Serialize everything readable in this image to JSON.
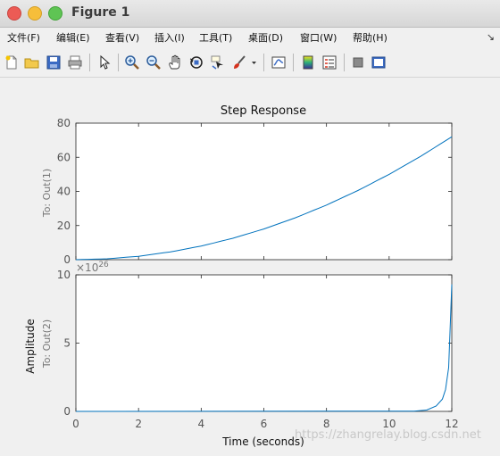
{
  "window": {
    "title": "Figure 1"
  },
  "menu": {
    "items": [
      "文件(F)",
      "编辑(E)",
      "查看(V)",
      "插入(I)",
      "工具(T)",
      "桌面(D)",
      "窗口(W)",
      "帮助(H)"
    ],
    "overflow": "↘"
  },
  "toolbar": {
    "icons": [
      "new-figure-icon",
      "open-icon",
      "save-icon",
      "print-icon",
      "pointer-icon",
      "zoom-in-icon",
      "zoom-out-icon",
      "pan-icon",
      "rotate-icon",
      "data-cursor-icon",
      "brush-icon",
      "link-plot-icon",
      "colorbar-icon",
      "legend-icon",
      "hide-plot-tools-icon",
      "show-plot-tools-icon"
    ]
  },
  "chart_data": [
    {
      "type": "line",
      "title": "Step Response",
      "ylabel": "To: Out(1)",
      "xlim": [
        0,
        12
      ],
      "ylim": [
        0,
        80
      ],
      "yticks": [
        "0",
        "20",
        "40",
        "60",
        "80"
      ],
      "series": [
        {
          "x": [
            0,
            1,
            2,
            3,
            4,
            5,
            6,
            7,
            8,
            9,
            10,
            11,
            12
          ],
          "y": [
            0,
            0.5,
            2,
            4.5,
            8,
            12.5,
            18,
            24.5,
            32,
            40.5,
            50,
            60.5,
            72
          ]
        }
      ],
      "color": "#0072bd"
    },
    {
      "type": "line",
      "ylabel": "To: Out(2)",
      "exponent_label": "×10",
      "exponent_power": "26",
      "xlabel": "Time (seconds)",
      "xlim": [
        0,
        12
      ],
      "ylim": [
        0,
        10
      ],
      "xticks": [
        "0",
        "2",
        "4",
        "6",
        "8",
        "10",
        "12"
      ],
      "yticks": [
        "0",
        "5",
        "10"
      ],
      "series": [
        {
          "x": [
            0,
            10.8,
            11.2,
            11.5,
            11.7,
            11.8,
            11.9,
            12
          ],
          "y": [
            0,
            0.02,
            0.1,
            0.4,
            0.9,
            1.6,
            3.2,
            9.3
          ]
        }
      ],
      "color": "#0072bd"
    }
  ],
  "shared": {
    "amplitude_label": "Amplitude"
  },
  "watermark": "https://zhangrelay.blog.csdn.net"
}
